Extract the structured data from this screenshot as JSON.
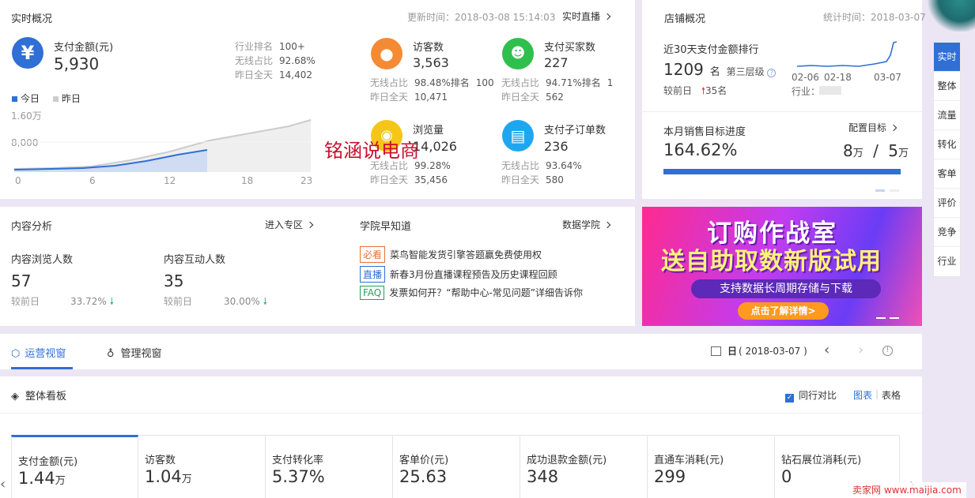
{
  "realtime": {
    "title": "实时概况",
    "update_label": "更新时间：2018-03-08 15:14:03",
    "live_link": "实时直播",
    "pay": {
      "label": "支付金额(元)",
      "value": "5,930",
      "stats": [
        {
          "k": "行业排名",
          "v": "100+"
        },
        {
          "k": "无线占比",
          "v": "92.68%"
        },
        {
          "k": "昨日全天",
          "v": "14,402"
        }
      ]
    },
    "legend_today": "今日",
    "legend_yesterday": "昨日",
    "y_ticks": [
      "1.60万",
      "8,000"
    ],
    "x_ticks": [
      "0",
      "6",
      "12",
      "18",
      "23"
    ],
    "metrics": [
      {
        "label": "访客数",
        "value": "3,563",
        "l1": "无线占比",
        "v1": "98.48%排名",
        "x1": "100",
        "l2": "昨日全天",
        "v2": "10,471"
      },
      {
        "label": "支付买家数",
        "value": "227",
        "l1": "无线占比",
        "v1": "94.71%排名",
        "x1": "1(",
        "l2": "昨日全天",
        "v2": "562"
      },
      {
        "label": "浏览量",
        "value": "14,026",
        "l1": "无线占比",
        "v1": "99.28%",
        "x1": "",
        "l2": "昨日全天",
        "v2": "35,456"
      },
      {
        "label": "支付子订单数",
        "value": "236",
        "l1": "无线占比",
        "v1": "93.64%",
        "x1": "",
        "l2": "昨日全天",
        "v2": "580"
      }
    ],
    "watermark": "铭涵说电商"
  },
  "shop": {
    "title": "店铺概况",
    "stat_time": "统计时间：2018-03-07",
    "rank_title": "近30天支付金额排行",
    "rank_value": "1209",
    "rank_unit": "名",
    "rank_level": "第三层级",
    "compare_label": "较前日",
    "compare_value": "35名",
    "spark_x": [
      "02-06",
      "02-18",
      "03-07"
    ],
    "industry_label": "行业：",
    "target_title": "本月销售目标进度",
    "target_link": "配置目标",
    "target_percent": "164.62%",
    "target_actual": "8",
    "target_goal": "5",
    "target_unit": "万",
    "target_progress": 1.0
  },
  "content": {
    "title": "内容分析",
    "link": "进入专区",
    "browse_label": "内容浏览人数",
    "browse_value": "57",
    "browse_cmp_label": "较前日",
    "browse_cmp": "33.72%",
    "interact_label": "内容互动人数",
    "interact_value": "35",
    "interact_cmp_label": "较前日",
    "interact_cmp": "30.00%"
  },
  "academy": {
    "title": "学院早知道",
    "link": "数据学院",
    "items": [
      {
        "tag": "必看",
        "text": "菜鸟智能发货引擎答题赢免费使用权"
      },
      {
        "tag": "直播",
        "text": "新春3月份直播课程预告及历史课程回顾"
      },
      {
        "tag": "FAQ",
        "text": "发票如何开？“帮助中心-常见问题”详细告诉你"
      }
    ]
  },
  "banner": {
    "line1": "订购作战室",
    "line2": "送自助取数新版试用",
    "line3": "支持数据长周期存储与下载",
    "cta": "点击了解详情>"
  },
  "tabs": {
    "ops": "运营视窗",
    "mgmt": "管理视窗",
    "date_prefix": "日",
    "date": "( 2018-03-07 )"
  },
  "board": {
    "title": "整体看板",
    "compare": "同行对比",
    "chart": "图表",
    "table": "表格",
    "cards": [
      {
        "label": "支付金额(元)",
        "value": "1.44",
        "unit": "万"
      },
      {
        "label": "访客数",
        "value": "1.04",
        "unit": "万"
      },
      {
        "label": "支付转化率",
        "value": "5.37%",
        "unit": ""
      },
      {
        "label": "客单价(元)",
        "value": "25.63",
        "unit": ""
      },
      {
        "label": "成功退款金额(元)",
        "value": "348",
        "unit": ""
      },
      {
        "label": "直通车消耗(元)",
        "value": "299",
        "unit": ""
      },
      {
        "label": "钻石展位消耗(元)",
        "value": "0",
        "unit": ""
      }
    ]
  },
  "sidebar": [
    "实时",
    "整体",
    "流量",
    "转化",
    "客单",
    "评价",
    "竞争",
    "行业"
  ],
  "corner_mark": "卖家网 www.maijia.com",
  "colors": {
    "accent": "#2f6fd6",
    "up": "#e8383d",
    "down": "#25b894"
  }
}
